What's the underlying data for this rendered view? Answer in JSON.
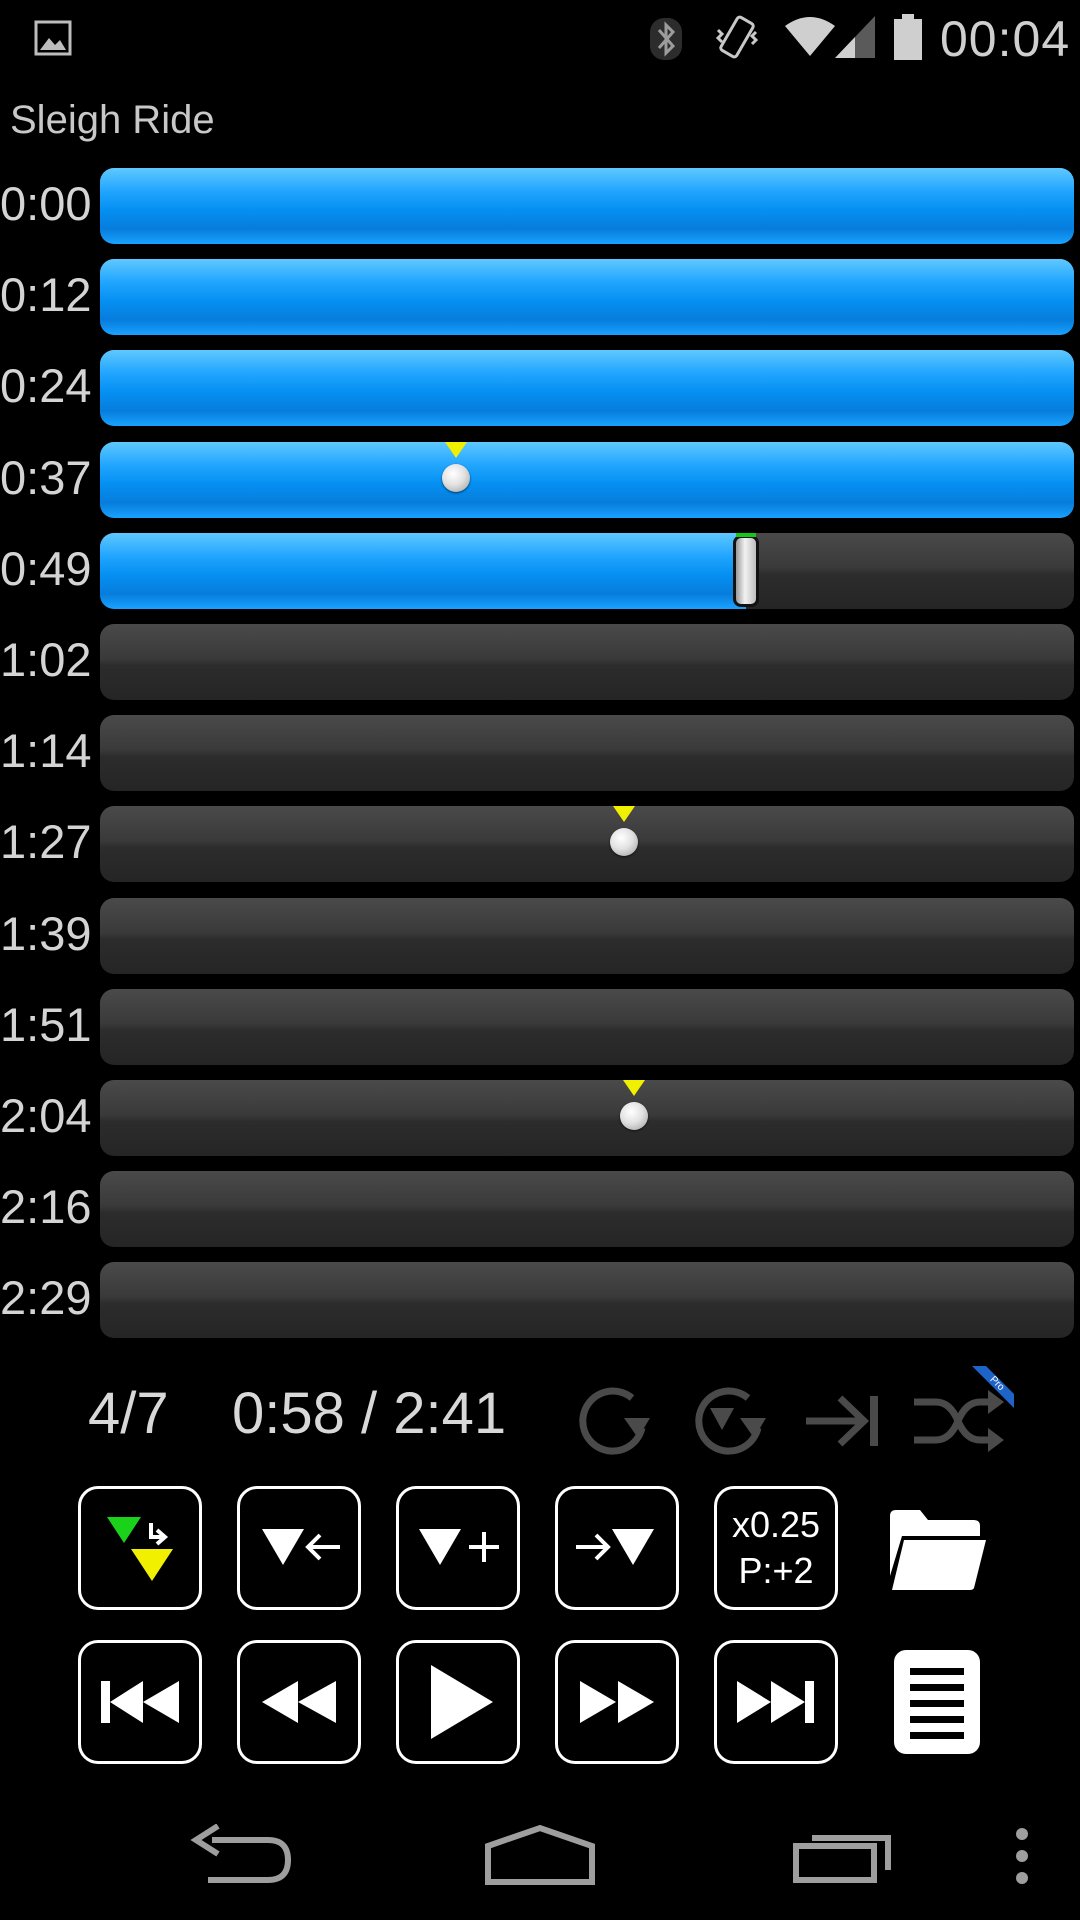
{
  "status_bar": {
    "time": "00:04",
    "icons": [
      "image-icon",
      "bluetooth-icon",
      "vibrate-icon",
      "wifi-icon",
      "signal-icon",
      "battery-icon"
    ]
  },
  "song": {
    "title": "Sleigh Ride"
  },
  "timeline": {
    "rows": [
      {
        "time": "0:00",
        "progress": 1.0
      },
      {
        "time": "0:12",
        "progress": 1.0
      },
      {
        "time": "0:24",
        "progress": 1.0
      },
      {
        "time": "0:37",
        "progress": 1.0,
        "marker": 0.365
      },
      {
        "time": "0:49",
        "progress": 0.663,
        "playhead": 0.663
      },
      {
        "time": "1:02",
        "progress": 0
      },
      {
        "time": "1:14",
        "progress": 0
      },
      {
        "time": "1:27",
        "progress": 0,
        "marker": 0.538
      },
      {
        "time": "1:39",
        "progress": 0
      },
      {
        "time": "1:51",
        "progress": 0
      },
      {
        "time": "2:04",
        "progress": 0,
        "marker": 0.548
      },
      {
        "time": "2:16",
        "progress": 0
      },
      {
        "time": "2:29",
        "progress": 0
      }
    ],
    "colors": {
      "played": "#0590f2",
      "unplayed": "#333333",
      "marker": "#f0f000",
      "playhead_top": "#18c818"
    }
  },
  "info": {
    "track_count": "4/7",
    "time_readout": "0:58 / 2:41",
    "icons": [
      "repeat-icon",
      "repeat-marker-icon",
      "skip-to-end-icon",
      "shuffle-icon"
    ],
    "badge": "Pro"
  },
  "controls": {
    "row1": [
      {
        "name": "marker-jump-button",
        "icon": "marker-swap-icon"
      },
      {
        "name": "marker-back-button",
        "icon": "marker-left-icon"
      },
      {
        "name": "marker-add-button",
        "icon": "marker-add-icon"
      },
      {
        "name": "marker-forward-button",
        "icon": "marker-right-icon"
      }
    ],
    "speed": {
      "speed_label": "x0.25",
      "pitch_label": "P:+2"
    },
    "row2": [
      {
        "name": "skip-previous-button",
        "icon": "skip-previous-icon"
      },
      {
        "name": "rewind-button",
        "icon": "rewind-icon"
      },
      {
        "name": "play-button",
        "icon": "play-icon"
      },
      {
        "name": "fast-forward-button",
        "icon": "fast-forward-icon"
      },
      {
        "name": "skip-next-button",
        "icon": "skip-next-icon"
      }
    ],
    "side_icons": [
      "folder-icon",
      "playlist-icon"
    ]
  },
  "nav_bar": {
    "icons": [
      "back-icon",
      "home-icon",
      "recent-apps-icon",
      "overflow-menu-icon"
    ]
  }
}
